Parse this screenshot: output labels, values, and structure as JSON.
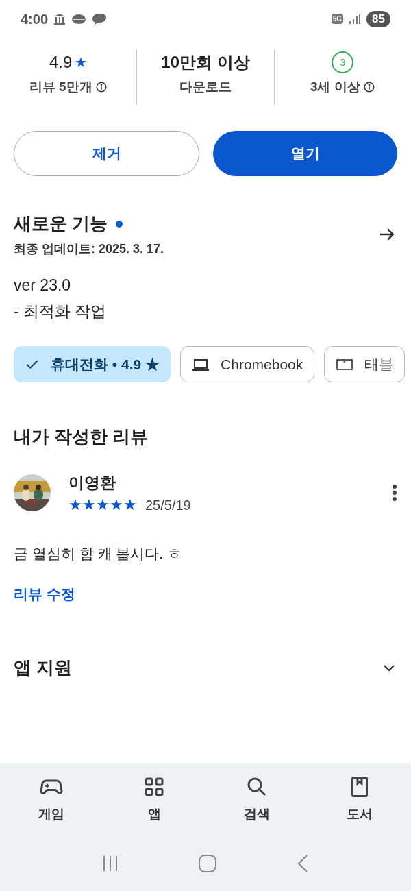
{
  "status_bar": {
    "time": "4:00",
    "network": "5G",
    "battery": "85"
  },
  "stats": [
    {
      "kind": "rating",
      "value": "4.9",
      "star": "★",
      "label": "리뷰 5만개",
      "info": true
    },
    {
      "kind": "text",
      "value": "10만회 이상",
      "label": "다운로드",
      "info": false
    },
    {
      "kind": "age",
      "value": "3",
      "label": "3세 이상",
      "info": true
    }
  ],
  "buttons": [
    {
      "label": "제거",
      "kind": "outline"
    },
    {
      "label": "열기",
      "kind": "filled"
    }
  ],
  "whats_new": {
    "title": "새로운 기능",
    "updated": "최종 업데이트: 2025. 3. 17.",
    "lines": [
      "ver 23.0",
      "- 최적화 작업"
    ]
  },
  "devices": [
    {
      "kind": "phone",
      "label": "휴대전화 • 4.9",
      "star": "★",
      "selected": true
    },
    {
      "kind": "laptop",
      "label": "Chromebook",
      "selected": false
    },
    {
      "kind": "tablet",
      "label": "태블",
      "selected": false
    }
  ],
  "my_review": {
    "title": "내가 작성한 리뷰",
    "author": "이영환",
    "stars": 5,
    "date": "25/5/19",
    "text": "금 열심히 함 캐 봅시다. ㅎ",
    "edit_link": "리뷰 수정"
  },
  "app_support": {
    "title": "앱 지원",
    "expanded": false
  },
  "bottom_nav": [
    {
      "kind": "games",
      "label": "게임"
    },
    {
      "kind": "apps",
      "label": "앱"
    },
    {
      "kind": "search",
      "label": "검색"
    },
    {
      "kind": "books",
      "label": "도서"
    }
  ]
}
